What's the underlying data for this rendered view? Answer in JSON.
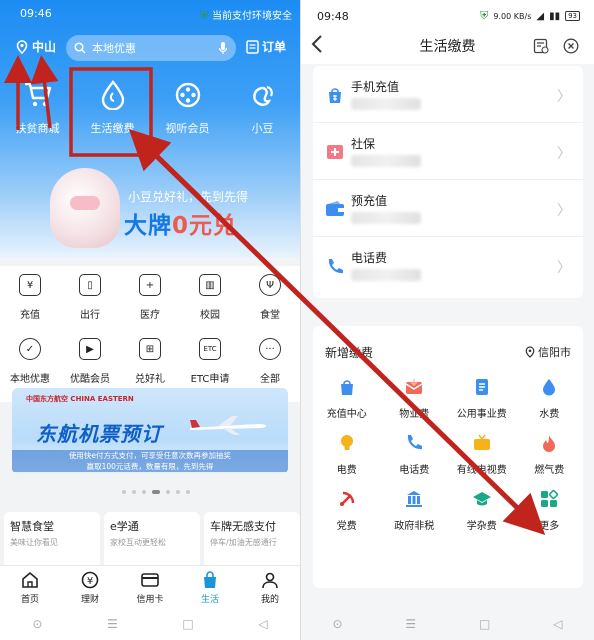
{
  "left": {
    "status": {
      "time": "09:46",
      "notice": "当前支付环境安全"
    },
    "header": {
      "city": "中山",
      "search_placeholder": "本地优惠",
      "orders": "订单"
    },
    "quick": [
      {
        "label": "扶贫商城",
        "icon": "cart-icon"
      },
      {
        "label": "生活缴费",
        "icon": "water-drop-icon"
      },
      {
        "label": "视听会员",
        "icon": "film-reel-icon"
      },
      {
        "label": "小豆",
        "icon": "bean-icon"
      }
    ],
    "banner": {
      "line1": "小豆兑好礼，先到先得",
      "line2a": "大牌",
      "line2b": "0元兑"
    },
    "grid": [
      {
        "label": "充值",
        "icon": "phone-recharge-icon"
      },
      {
        "label": "出行",
        "icon": "luggage-icon"
      },
      {
        "label": "医疗",
        "icon": "medical-icon"
      },
      {
        "label": "校园",
        "icon": "book-icon"
      },
      {
        "label": "食堂",
        "icon": "cutlery-icon"
      },
      {
        "label": "本地优惠",
        "icon": "location-discount-icon"
      },
      {
        "label": "优酷会员",
        "icon": "video-icon"
      },
      {
        "label": "兑好礼",
        "icon": "gift-icon"
      },
      {
        "label": "ETC申请",
        "icon": "etc-icon"
      },
      {
        "label": "全部",
        "icon": "more-dots-icon"
      }
    ],
    "ad": {
      "logo": "中国东方航空 CHINA EASTERN",
      "title": "东航机票预订",
      "sub1": "使用快e付方式支付，可享受任意次数再参加抽奖",
      "sub2": "赢取100元话费，数量有限，先到先得"
    },
    "cards": [
      {
        "title": "智慧食堂",
        "sub": "美味让你看见"
      },
      {
        "title": "e学通",
        "sub": "家校互动更轻松"
      },
      {
        "title": "车牌无感支付",
        "sub": "停车/加油无感通行"
      }
    ],
    "tabs": [
      {
        "label": "首页",
        "icon": "home-icon"
      },
      {
        "label": "理财",
        "icon": "yen-coin-icon"
      },
      {
        "label": "信用卡",
        "icon": "credit-card-icon"
      },
      {
        "label": "生活",
        "icon": "shopping-bag-icon"
      },
      {
        "label": "我的",
        "icon": "person-icon"
      }
    ],
    "nav": [
      "⊙",
      "☰",
      "□",
      "◁"
    ]
  },
  "right": {
    "status": {
      "time": "09:48",
      "speed": "9.00 KB/s",
      "battery": "93"
    },
    "title": "生活缴费",
    "accounts": [
      {
        "name": "手机充值"
      },
      {
        "name": "社保"
      },
      {
        "name": "预充值"
      },
      {
        "name": "电话费"
      }
    ],
    "new_payments": {
      "heading": "新增缴费",
      "city": "信阳市",
      "items": [
        {
          "label": "充值中心",
          "icon": "bag-recharge-icon",
          "color": "#3c8ef0"
        },
        {
          "label": "物业费",
          "icon": "envelope-icon",
          "color": "#f06a5a"
        },
        {
          "label": "公用事业费",
          "icon": "document-icon",
          "color": "#3c8ef0"
        },
        {
          "label": "水费",
          "icon": "water-drop-icon",
          "color": "#3c8ef0"
        },
        {
          "label": "电费",
          "icon": "bulb-icon",
          "color": "#f5b21b"
        },
        {
          "label": "电话费",
          "icon": "phone-icon",
          "color": "#3c8ef0"
        },
        {
          "label": "有线电视费",
          "icon": "tv-icon",
          "color": "#f5b21b"
        },
        {
          "label": "燃气费",
          "icon": "flame-icon",
          "color": "#f06a5a"
        },
        {
          "label": "党费",
          "icon": "party-emblem-icon",
          "color": "#e2332b"
        },
        {
          "label": "政府非税",
          "icon": "building-icon",
          "color": "#3c8ef0"
        },
        {
          "label": "学杂费",
          "icon": "graduation-cap-icon",
          "color": "#1aa886"
        },
        {
          "label": "更多",
          "icon": "more-grid-icon",
          "color": "#1aa886"
        }
      ]
    },
    "nav": [
      "⊙",
      "☰",
      "□",
      "◁"
    ]
  },
  "colors": {
    "brand_blue": "#1c8cf3",
    "annotation_red": "#c0241d",
    "life_tab": "#1a96d8"
  }
}
